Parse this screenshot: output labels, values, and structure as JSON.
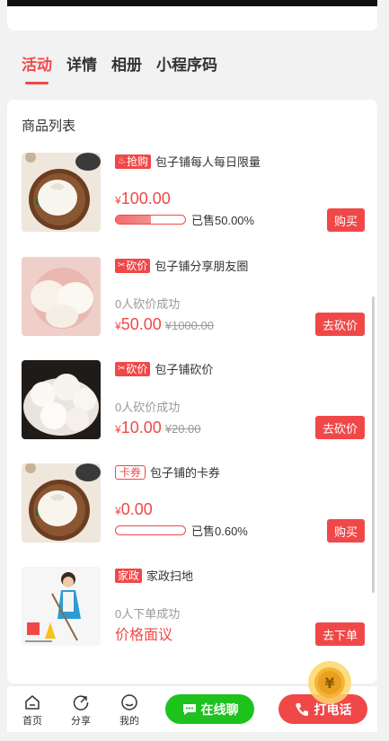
{
  "tabs": [
    {
      "label": "活动",
      "active": true
    },
    {
      "label": "详情",
      "active": false
    },
    {
      "label": "相册",
      "active": false
    },
    {
      "label": "小程序码",
      "active": false
    }
  ],
  "list_title": "商品列表",
  "items": [
    {
      "badge": "抢购",
      "badge_icon": "fire-icon",
      "title": "包子铺每人每日限量",
      "price": "100.00",
      "progress_percent": 50,
      "sold_text": "已售50.00%",
      "button": "购买"
    },
    {
      "badge": "砍价",
      "badge_icon": "scissors-icon",
      "title": "包子铺分享朋友圈",
      "sub": "0人砍价成功",
      "price": "50.00",
      "orig_price": "¥1000.00",
      "button": "去砍价"
    },
    {
      "badge": "砍价",
      "badge_icon": "scissors-icon",
      "title": "包子铺砍价",
      "sub": "0人砍价成功",
      "price": "10.00",
      "orig_price": "¥20.00",
      "button": "去砍价"
    },
    {
      "badge": "卡券",
      "title": "包子铺的卡券",
      "price": "0.00",
      "progress_percent": 0.6,
      "sold_text": "已售0.60%",
      "button": "购买"
    },
    {
      "badge": "家政",
      "title": "家政扫地",
      "sub": "0人下单成功",
      "price_text": "价格面议",
      "button": "去下单"
    }
  ],
  "currency": "¥",
  "bottom_nav": [
    {
      "label": "首页",
      "icon": "home-icon"
    },
    {
      "label": "分享",
      "icon": "share-icon"
    },
    {
      "label": "我的",
      "icon": "profile-icon"
    }
  ],
  "chat_label": "在线聊",
  "call_label": "打电话",
  "colors": {
    "accent": "#f04848",
    "chat": "#1dc21d",
    "coin": "#f5b335"
  }
}
